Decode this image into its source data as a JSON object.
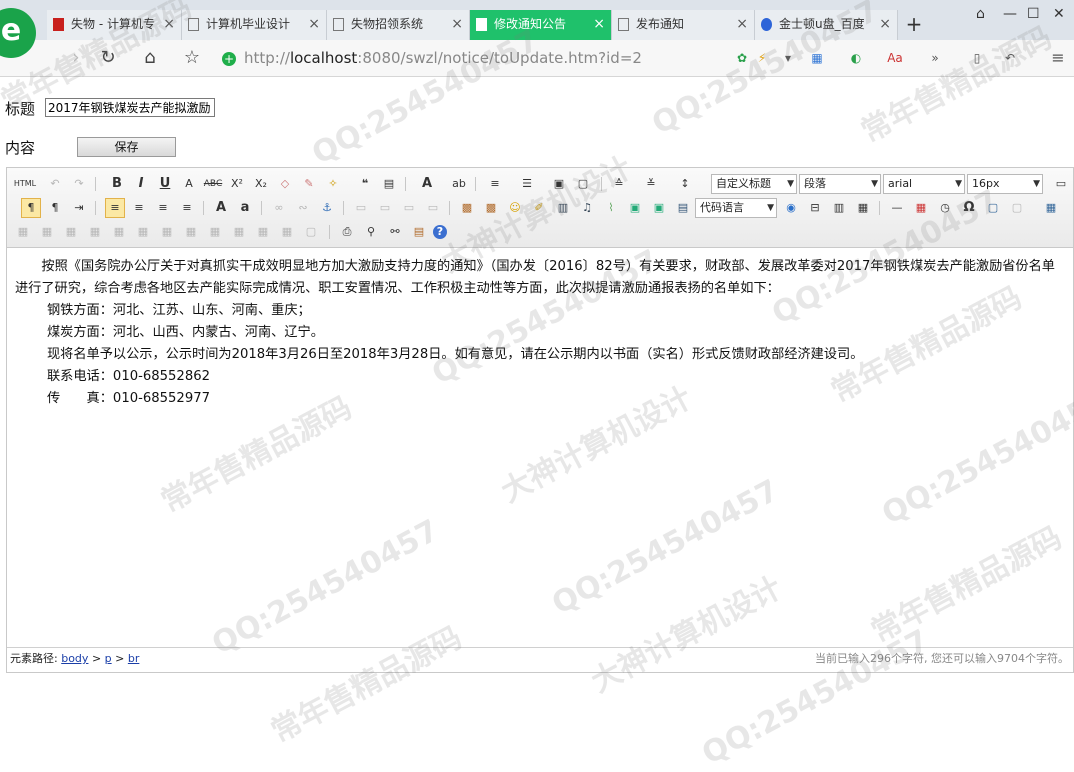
{
  "browser": {
    "tabs": [
      {
        "label": "失物 - 计算机专",
        "close": "×"
      },
      {
        "label": "计算机毕业设计",
        "close": "×"
      },
      {
        "label": "失物招领系统",
        "close": "×"
      },
      {
        "label": "修改通知公告",
        "close": "×"
      },
      {
        "label": "发布通知",
        "close": "×"
      },
      {
        "label": "金士顿u盘_百度",
        "close": "×"
      }
    ],
    "new_tab": "+",
    "url_prefix": "http://",
    "url_host": "localhost",
    "url_rest": ":8080/swzl/notice/toUpdate.htm?id=2"
  },
  "form": {
    "title_label": "标题",
    "title_value": "2017年钢铁煤炭去产能拟激励",
    "content_label": "内容",
    "save_label": "保存"
  },
  "toolbar": {
    "html_label": "HTML",
    "heading_select": "自定义标题",
    "paragraph_select": "段落",
    "font_select": "arial",
    "size_select": "16px",
    "code_select": "代码语言"
  },
  "content": {
    "paragraphs": [
      "按照《国务院办公厅关于对真抓实干成效明显地方加大激励支持力度的通知》（国办发〔2016〕82号）有关要求，财政部、发展改革委对2017年钢铁煤炭去产能激励省份名单进行了研究，综合考虑各地区去产能实际完成情况、职工安置情况、工作积极主动性等方面，此次拟提请激励通报表扬的名单如下：",
      "钢铁方面：河北、江苏、山东、河南、重庆；",
      "煤炭方面：河北、山西、内蒙古、河南、辽宁。",
      "现将名单予以公示，公示时间为2018年3月26日至2018年3月28日。如有意见，请在公示期内以书面（实名）形式反馈财政部经济建设司。",
      "联系电话：010-68552862",
      "传　　真：010-68552977"
    ]
  },
  "statusbar": {
    "path_label": "元素路径:",
    "path_items": [
      "body",
      "p",
      "br"
    ],
    "separator": ">",
    "count_text": "当前已输入296个字符, 您还可以输入9704个字符。"
  },
  "watermark": {
    "qq": "QQ:254540457",
    "slogan1": "常年售精品源码",
    "slogan2": "大神计算机设计"
  }
}
